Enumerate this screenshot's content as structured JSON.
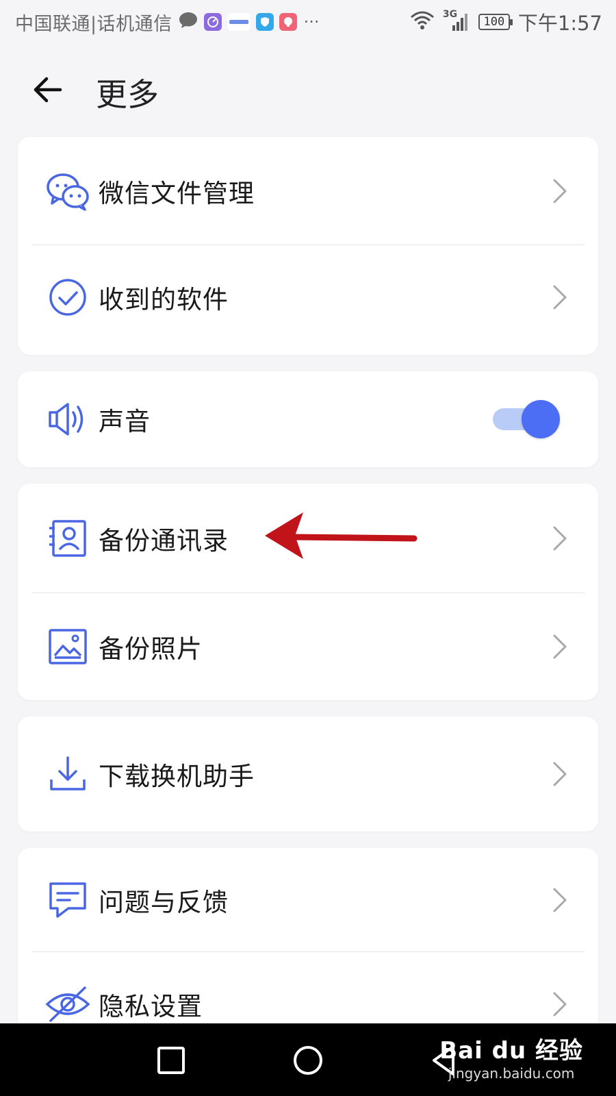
{
  "status_bar": {
    "carrier": "中国联通|话机通信",
    "more_indicator": "···",
    "network": "3G",
    "battery": "100",
    "time": "下午1:57",
    "icons": [
      "chat-bubble-icon",
      "speedometer-app-icon",
      "news-app-icon",
      "shield-app-icon",
      "elephant-app-icon",
      "wifi-icon",
      "signal-icon",
      "battery-icon"
    ]
  },
  "header": {
    "title": "更多"
  },
  "menu": {
    "wechat_files": "微信文件管理",
    "received_software": "收到的软件",
    "sound": "声音",
    "sound_enabled": true,
    "backup_contacts": "备份通讯录",
    "backup_photos": "备份照片",
    "download_assistant": "下载换机助手",
    "feedback": "问题与反馈",
    "privacy": "隐私设置"
  },
  "colors": {
    "accent": "#4b6ef5",
    "icon_blue": "#4a67e3",
    "toggle_track": "#b9ccf8",
    "annotation_red": "#c0141a",
    "background": "#f5f5f7"
  },
  "watermark": {
    "logo": "Bai du 经验",
    "url": "jingyan.baidu.com"
  }
}
